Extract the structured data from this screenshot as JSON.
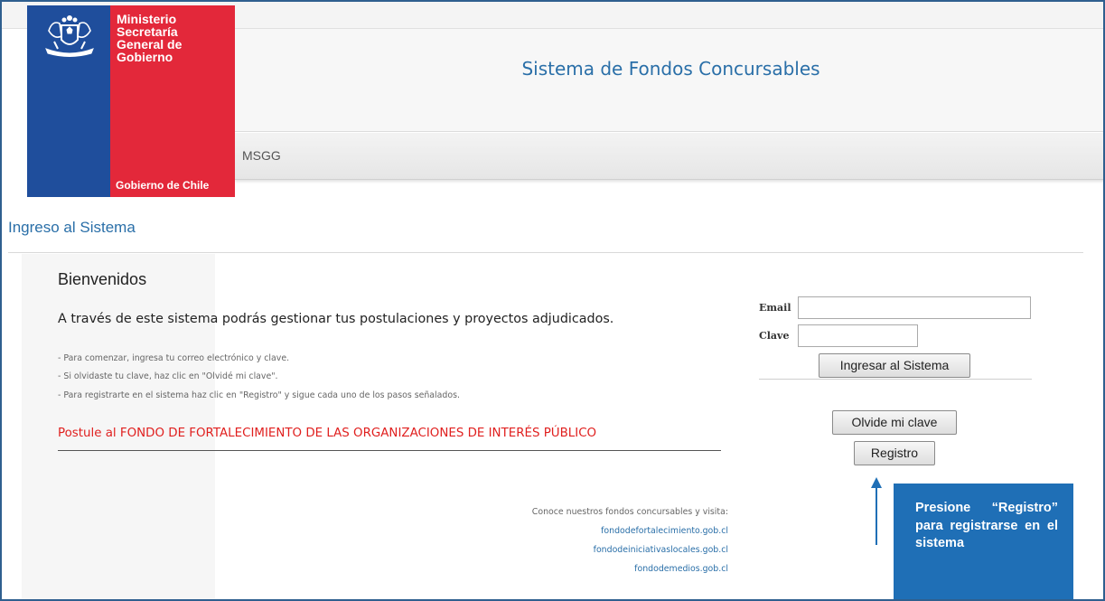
{
  "header": {
    "system_title": "Sistema de Fondos Concursables",
    "nav_item": "MSGG"
  },
  "logo": {
    "ministry_name": "Ministerio Secretaría General de Gobierno",
    "government_label": "Gobierno de Chile",
    "colors": {
      "blue": "#1f4e9c",
      "red": "#e3283a"
    }
  },
  "page": {
    "heading": "Ingreso al Sistema",
    "welcome": "Bienvenidos",
    "intro": "A través de este sistema podrás gestionar tus postulaciones y proyectos adjudicados.",
    "instructions": [
      "- Para comenzar, ingresa tu correo electrónico y clave.",
      "- Si olvidaste tu clave, haz clic en \"Olvidé mi clave\".",
      "- Para registrarte en el sistema haz clic en \"Registro\" y sigue cada uno de los pasos señalados."
    ],
    "fund_link": "Postule al FONDO DE FORTALECIMIENTO DE LAS ORGANIZACIONES DE INTERÉS PÚBLICO",
    "visit_text": "Conoce nuestros fondos concursables y visita:",
    "sites": [
      "fondodefortalecimiento.gob.cl",
      "fondodeiniciativaslocales.gob.cl",
      "fondodemedios.gob.cl"
    ]
  },
  "login": {
    "email_label": "Email",
    "password_label": "Clave",
    "email_value": "",
    "password_value": "",
    "submit_label": "Ingresar al Sistema",
    "forgot_label": "Olvide mi clave",
    "register_label": "Registro"
  },
  "callout": {
    "text": "Presione “Registro” para registrarse en el sistema"
  }
}
